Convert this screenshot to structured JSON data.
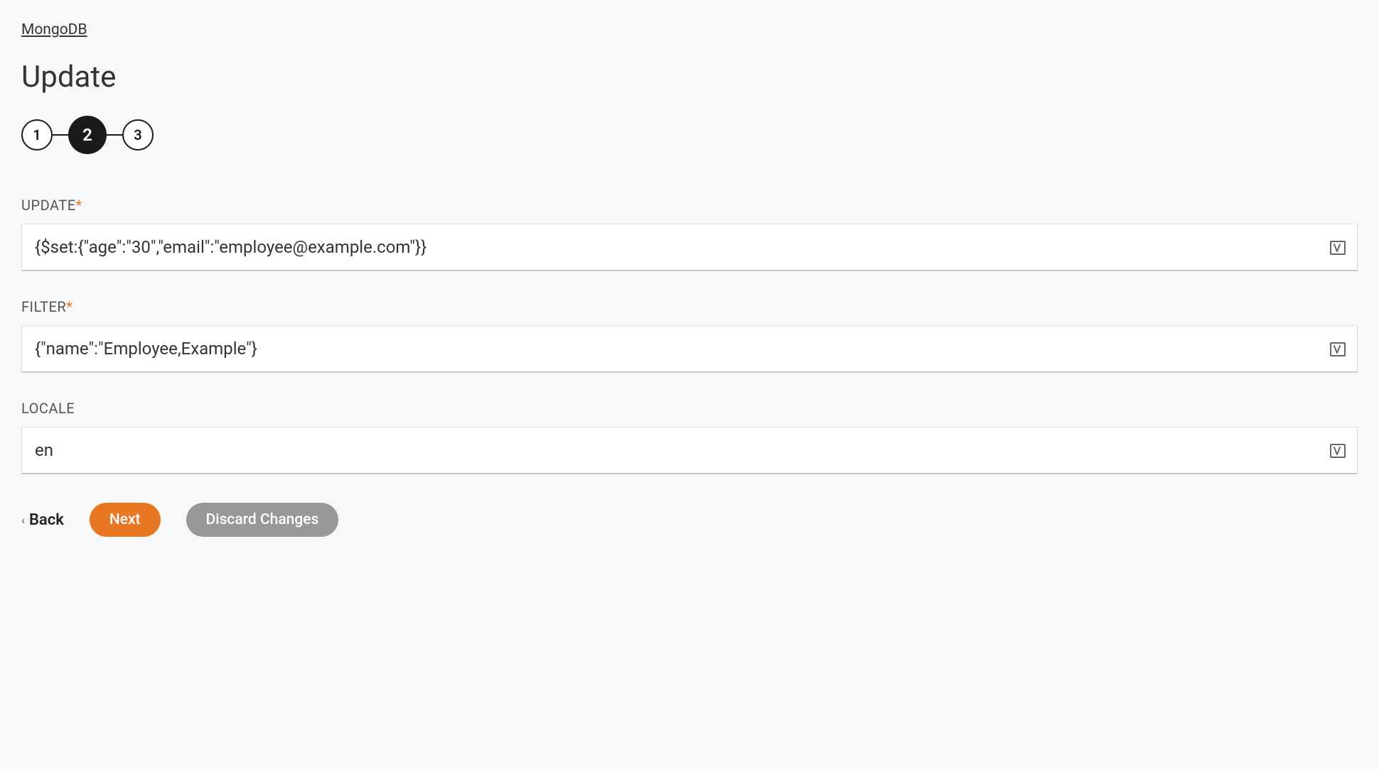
{
  "breadcrumb": {
    "label": "MongoDB"
  },
  "page": {
    "title": "Update"
  },
  "stepper": {
    "steps": [
      "1",
      "2",
      "3"
    ],
    "active": 2
  },
  "fields": {
    "update": {
      "label": "UPDATE",
      "required": true,
      "value": "{$set:{\"age\":\"30\",\"email\":\"employee@example.com\"}}"
    },
    "filter": {
      "label": "FILTER",
      "required": true,
      "value": "{\"name\":\"Employee,Example\"}"
    },
    "locale": {
      "label": "LOCALE",
      "required": false,
      "value": "en"
    }
  },
  "actions": {
    "back": "Back",
    "next": "Next",
    "discard": "Discard Changes"
  },
  "icons": {
    "variable": "variable-icon"
  }
}
